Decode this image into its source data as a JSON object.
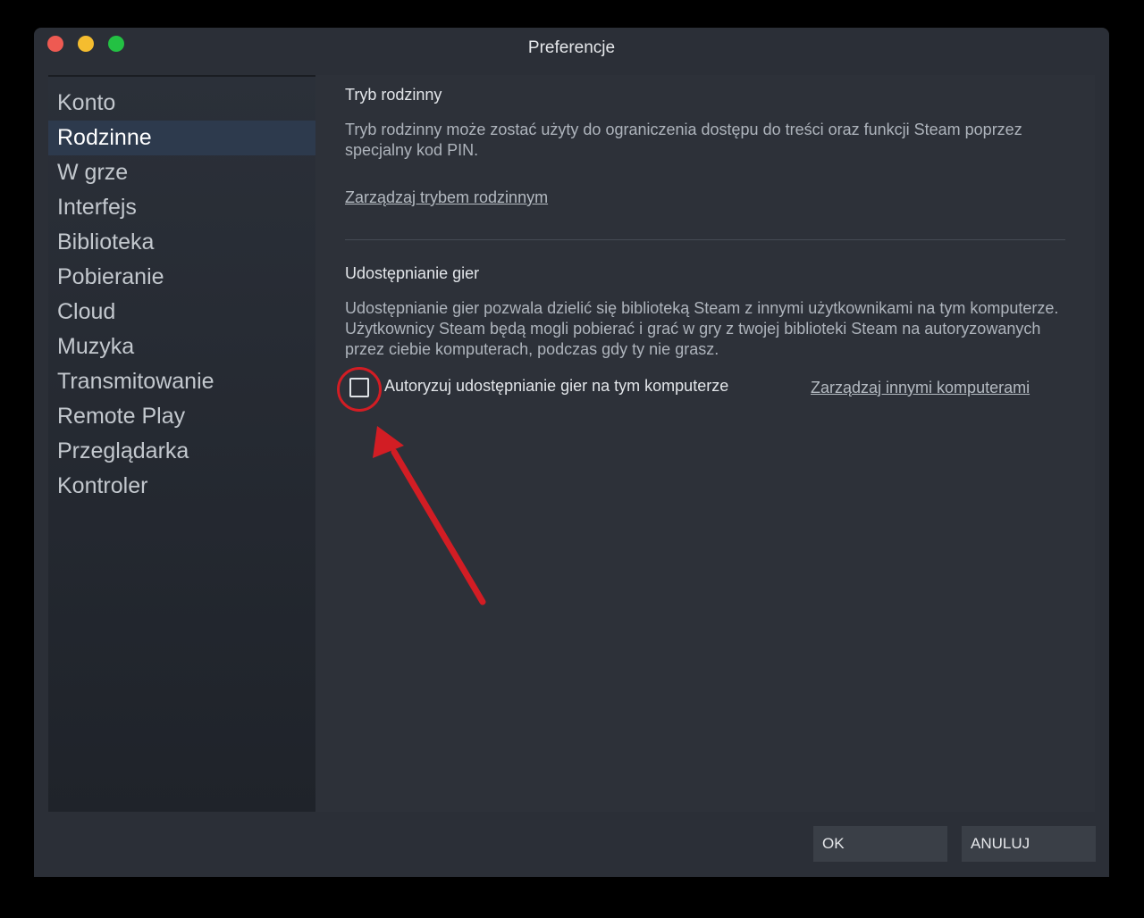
{
  "window": {
    "title": "Preferencje"
  },
  "sidebar": {
    "items": [
      {
        "label": "Konto"
      },
      {
        "label": "Rodzinne"
      },
      {
        "label": "W grze"
      },
      {
        "label": "Interfejs"
      },
      {
        "label": "Biblioteka"
      },
      {
        "label": "Pobieranie"
      },
      {
        "label": "Cloud"
      },
      {
        "label": "Muzyka"
      },
      {
        "label": "Transmitowanie"
      },
      {
        "label": "Remote Play"
      },
      {
        "label": "Przeglądarka"
      },
      {
        "label": "Kontroler"
      }
    ],
    "active_index": 1
  },
  "family": {
    "title": "Tryb rodzinny",
    "description": "Tryb rodzinny może zostać użyty do ograniczenia dostępu do treści oraz funkcji Steam poprzez specjalny kod PIN.",
    "manage_link": "Zarządzaj trybem rodzinnym"
  },
  "sharing": {
    "title": "Udostępnianie gier",
    "description": "Udostępnianie gier pozwala dzielić się biblioteką Steam z innymi użytkownikami na tym komputerze. Użytkownicy Steam będą mogli pobierać i grać w gry z twojej biblioteki Steam na autoryzowanych przez ciebie komputerach, podczas gdy ty nie grasz.",
    "checkbox_label": "Autoryzuj udostępnianie gier na tym komputerze",
    "checkbox_checked": false,
    "manage_link": "Zarządzaj innymi komputerami"
  },
  "footer": {
    "ok_label": "OK",
    "cancel_label": "ANULUJ"
  },
  "colors": {
    "accent_active": "#2d3a4d",
    "annotation_red": "#d21d24"
  }
}
